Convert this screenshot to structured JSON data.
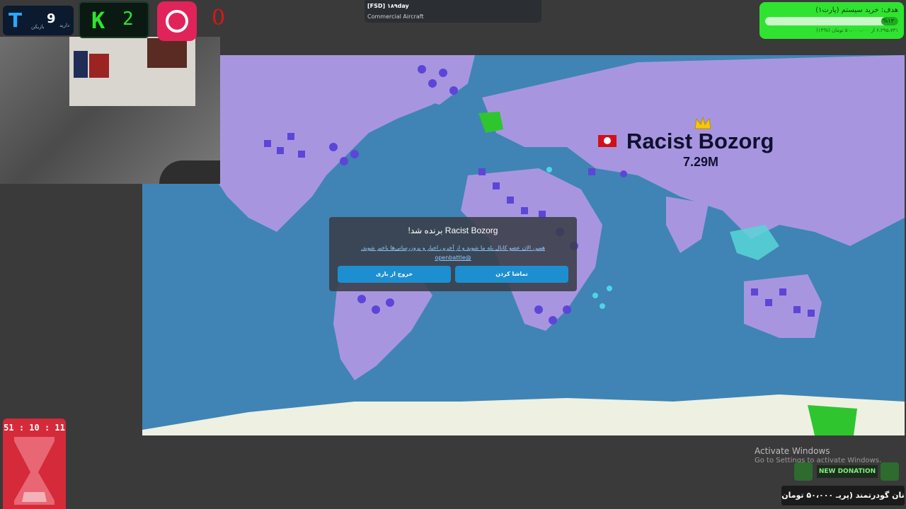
{
  "top_left_widget": {
    "count": "9",
    "label_dareed": "دارید",
    "label_bazikon": "بازیکن"
  },
  "k_widget": {
    "letter": "K",
    "number": "2"
  },
  "red_counter": {
    "value": "0"
  },
  "stream_info": {
    "title": "[FSD] ۱۸۹day",
    "subtitle": "Commercial Aircraft"
  },
  "goal": {
    "title": "هدف: خرید سیستم (پارت۱)",
    "percent_label": "%۱۳",
    "percent_value": 13,
    "amount_text": "۶،۲۹۵،۷۳۱ از ۵۰،۰۰۰،۰۰۰ تومان (%۱۳)"
  },
  "map": {
    "winner_name": "Racist Bozorg",
    "winner_score": "7.29M"
  },
  "modal": {
    "title": "!برنده شد Racist Bozorg",
    "message": "همین الان عضو کانال بله ما شوید و از آخرین اخبار و بروزرسانی‌ها باخبر شوید.",
    "handle": "openbattle@",
    "watch_button": "تماشا کردن",
    "exit_button": "خروج از بازی"
  },
  "timer": {
    "display": "51 : 10 : 11"
  },
  "windows_watermark": {
    "line1": "Activate Windows",
    "line2": "Go to Settings to activate Windows."
  },
  "new_donation": {
    "label": "NEW DONATION"
  },
  "donation_bar": {
    "text": "نان گودرتمند (پریـ ۵۰،۰۰۰ تومان"
  },
  "colors": {
    "map_ocean": "#3f84b5",
    "land": "#9d8fd6",
    "player": "#5d45d8",
    "green_team": "#2fc52f",
    "cyan_team": "#4fd4e6",
    "button": "#1d8fd0"
  }
}
